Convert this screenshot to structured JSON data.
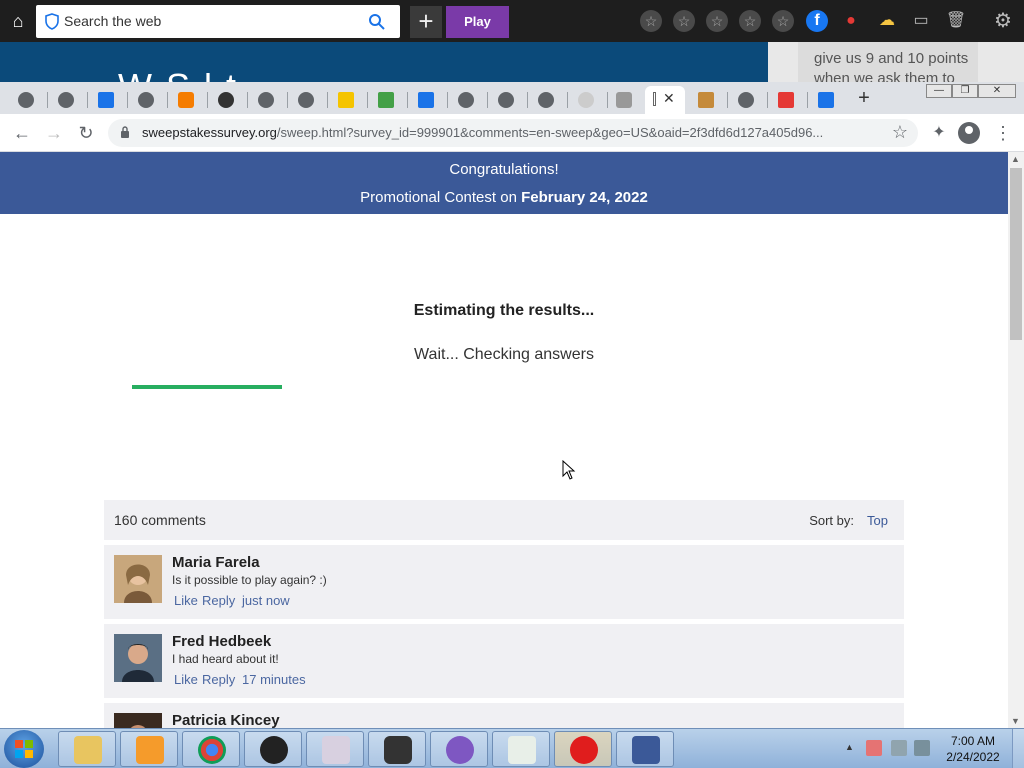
{
  "os_bar": {
    "search_placeholder": "Search the web",
    "play_label": "Play",
    "new_label": "+"
  },
  "background_page": {
    "heading_fragment": "W        S    l         t",
    "tooltip_line1": "give us 9 and 10 points",
    "tooltip_line2": "when we ask them to"
  },
  "browser": {
    "url_domain": "sweepstakessurvey.org",
    "url_rest": "/sweep.html?survey_id=999901&comments=en-sweep&geo=US&oaid=2f3dfd6d127a405d96...",
    "active_tab_close": "✕",
    "new_tab": "+"
  },
  "page": {
    "banner_line1": "Congratulations!",
    "banner_line2_prefix": "Promotional Contest on ",
    "banner_line2_date": "February 24, 2022",
    "estimating_title": "Estimating the results...",
    "estimating_subtitle": "Wait... Checking answers",
    "progress": 1.0,
    "progress_color": "#27ae60"
  },
  "comments": {
    "count_label": "160 comments",
    "sort_label": "Sort by:",
    "sort_value": "Top",
    "items": [
      {
        "name": "Maria Farela",
        "text": "Is it possible to play again? :)",
        "like": "Like",
        "reply": "Reply",
        "time": "just now"
      },
      {
        "name": "Fred Hedbeek",
        "text": "I had heard about it!",
        "like": "Like",
        "reply": "Reply",
        "time": "17 minutes"
      },
      {
        "name": "Patricia Kincey",
        "text": "",
        "like": "",
        "reply": "",
        "time": ""
      }
    ]
  },
  "taskbar": {
    "clock_time": "7:00 AM",
    "clock_date": "2/24/2022"
  },
  "colors": {
    "banner": "#3b5998",
    "link": "#4b67a1",
    "os_bar": "#1e1e1e",
    "play": "#7a3aa8"
  }
}
